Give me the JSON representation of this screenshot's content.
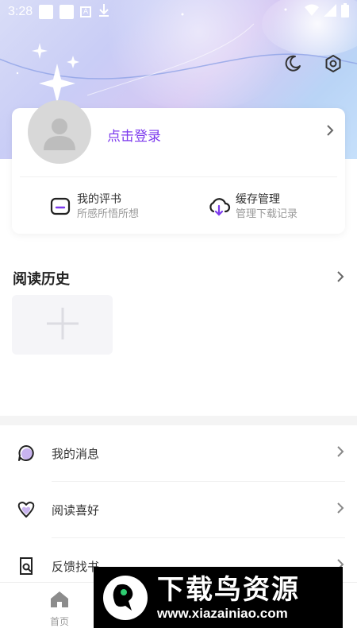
{
  "status_bar": {
    "time": "3:28"
  },
  "profile": {
    "login_label": "点击登录"
  },
  "features": [
    {
      "title": "我的评书",
      "subtitle": "所感所悟所想"
    },
    {
      "title": "缓存管理",
      "subtitle": "管理下载记录"
    }
  ],
  "history": {
    "title": "阅读历史"
  },
  "menu": [
    {
      "label": "我的消息",
      "icon": "message-icon"
    },
    {
      "label": "阅读喜好",
      "icon": "heart-icon"
    },
    {
      "label": "反馈找书",
      "icon": "search-book-icon"
    }
  ],
  "tabbar": {
    "home_label": "首页"
  },
  "watermark": {
    "title": "下载鸟资源",
    "url": "www.xiazainiao.com"
  },
  "colors": {
    "accent": "#7c3aed"
  }
}
